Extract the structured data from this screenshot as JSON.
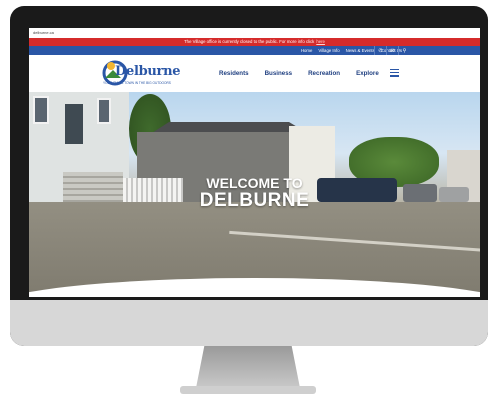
{
  "browser": {
    "url": "delburne.ca"
  },
  "alert_bar": {
    "message": "The Village office is currently closed to the public. For more info click",
    "link": "here"
  },
  "utility_nav": {
    "links": [
      "Home",
      "Village Info",
      "News & Events",
      "Contact Us"
    ],
    "icons": [
      "phone-icon",
      "mail-icon",
      "search-icon"
    ]
  },
  "brand": {
    "name": "Delburne",
    "tagline": "YOUR SMALL TOWN IN THE BIG OUTDOORS"
  },
  "main_nav": {
    "items": [
      "Residents",
      "Business",
      "Recreation",
      "Explore"
    ],
    "menu_icon": "hamburger-icon"
  },
  "hero": {
    "line1": "WELCOME TO",
    "line2": "DELBURNE"
  },
  "colors": {
    "alert": "#d52b2b",
    "utility": "#2a56a6",
    "brand_blue": "#1f3f80"
  }
}
